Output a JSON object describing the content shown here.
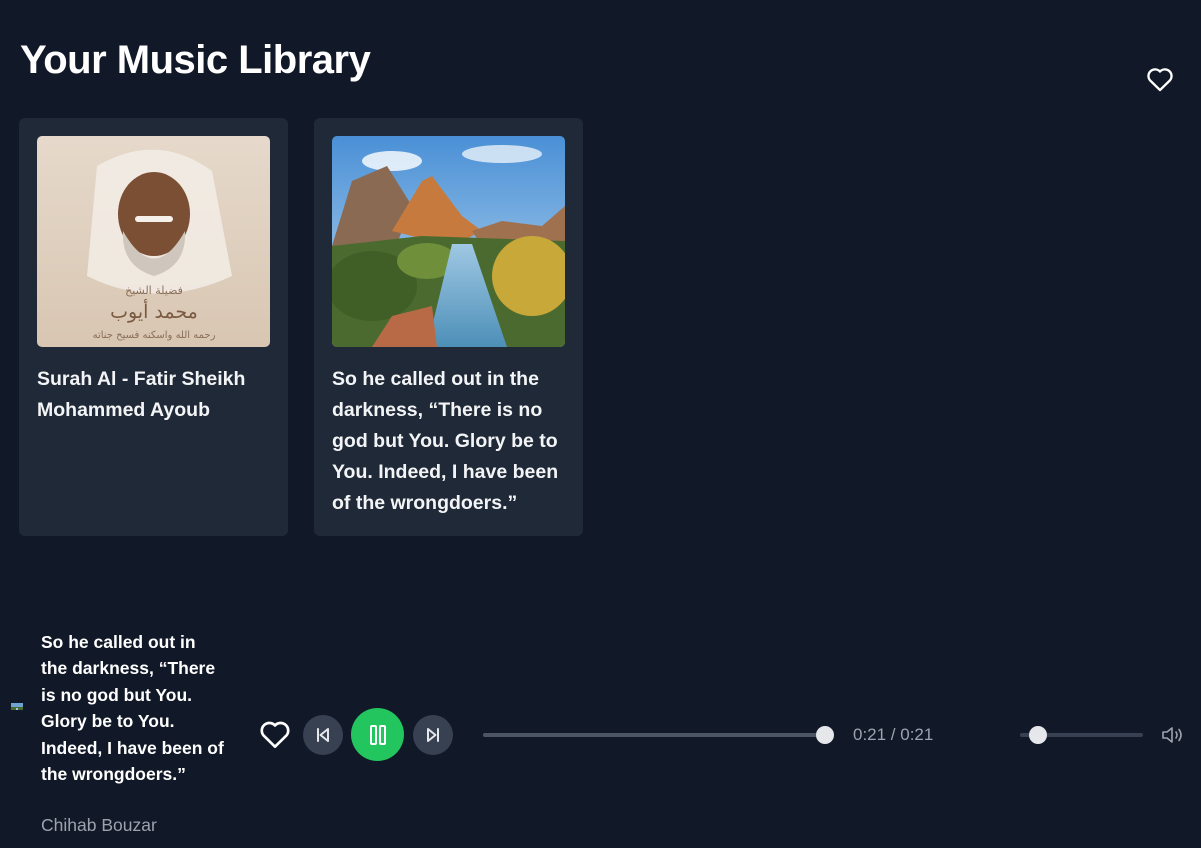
{
  "page": {
    "title": "Your Music Library"
  },
  "header": {
    "favorites_icon": "heart-outline-icon"
  },
  "library": {
    "cards": [
      {
        "title": "Surah Al - Fatir Sheikh Mohammed Ayoub",
        "art_caption_line1": "فضيلة الشيخ",
        "art_caption_line2": "محمد أيوب",
        "art_caption_line3": "رحمه الله واسكنه فسيح جناته"
      },
      {
        "title": "So he called out in the darkness, “There is no god but You. Glory be to You. Indeed, I have been of the wrongdoers.”"
      }
    ]
  },
  "player": {
    "title": "So he called out in the darkness, “There is no god but You. Glory be to You. Indeed, I have been of the wrongdoers.”",
    "artist": "Chihab Bouzar",
    "time": "0:21 / 0:21",
    "progress": 1.0,
    "volume": 0.15,
    "icons": {
      "like": "heart-outline-icon",
      "prev": "skip-back-icon",
      "play_pause": "pause-icon",
      "next": "skip-forward-icon",
      "volume": "volume-icon"
    },
    "accent": "#22c55e"
  }
}
